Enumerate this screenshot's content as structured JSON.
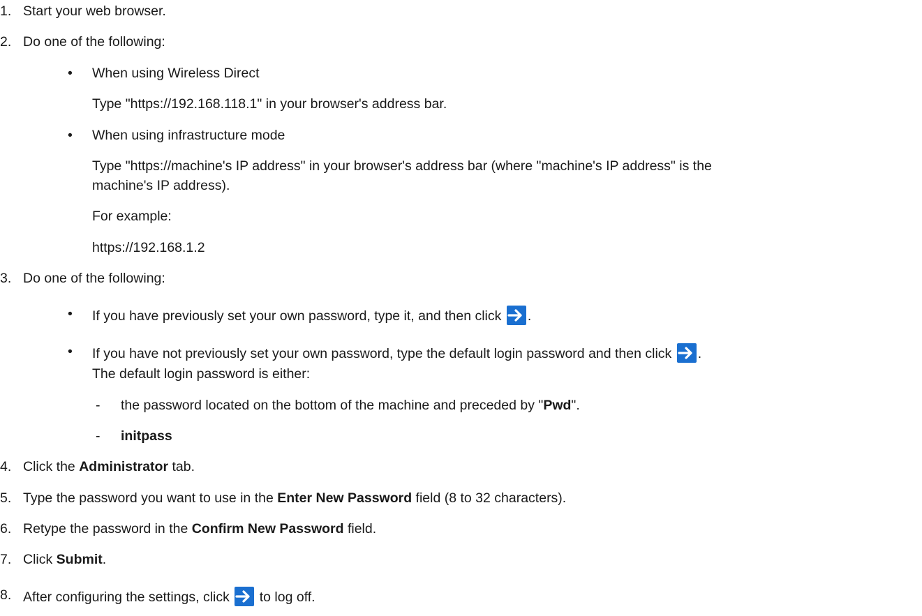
{
  "steps": {
    "s1": {
      "num": "1.",
      "text": "Start your web browser."
    },
    "s2": {
      "num": "2.",
      "text": "Do one of the following:",
      "b1": {
        "title": "When using Wireless Direct",
        "detail": "Type \"https://192.168.118.1\" in your browser's address bar."
      },
      "b2": {
        "title": "When using infrastructure mode",
        "detail_line1": "Type \"https://machine's IP address\" in your browser's address bar (where \"machine's IP address\" is the",
        "detail_line2": "machine's IP address).",
        "example_label": "For example:",
        "example_url": "https://192.168.1.2"
      }
    },
    "s3": {
      "num": "3.",
      "text": "Do one of the following:",
      "b1": {
        "text": "If you have previously set your own password, type it, and then click",
        "after": "."
      },
      "b2": {
        "text": "If you have not previously set your own password, type the default login password and then click",
        "after": ".",
        "note": "The default login password is either:",
        "d1": {
          "pre": "the password located on the bottom of the machine and preceded by \"",
          "bold": "Pwd",
          "post": "\"."
        },
        "d2": {
          "bold": "initpass"
        }
      }
    },
    "s4": {
      "num": "4.",
      "pre": "Click the ",
      "bold": "Administrator",
      "post": " tab."
    },
    "s5": {
      "num": "5.",
      "pre": "Type the password you want to use in the ",
      "bold": "Enter New Password",
      "post": " field (8 to 32 characters)."
    },
    "s6": {
      "num": "6.",
      "pre": "Retype the password in the ",
      "bold": "Confirm New Password",
      "post": " field."
    },
    "s7": {
      "num": "7.",
      "pre": "Click ",
      "bold": "Submit",
      "post": "."
    },
    "s8": {
      "num": "8.",
      "pre": "After configuring the settings, click",
      "post": "to log off."
    }
  },
  "bullet": "•",
  "dash": "-",
  "icon": {
    "name": "arrow-right-icon",
    "bg": "#1a6fd0",
    "fg": "#ffffff"
  }
}
